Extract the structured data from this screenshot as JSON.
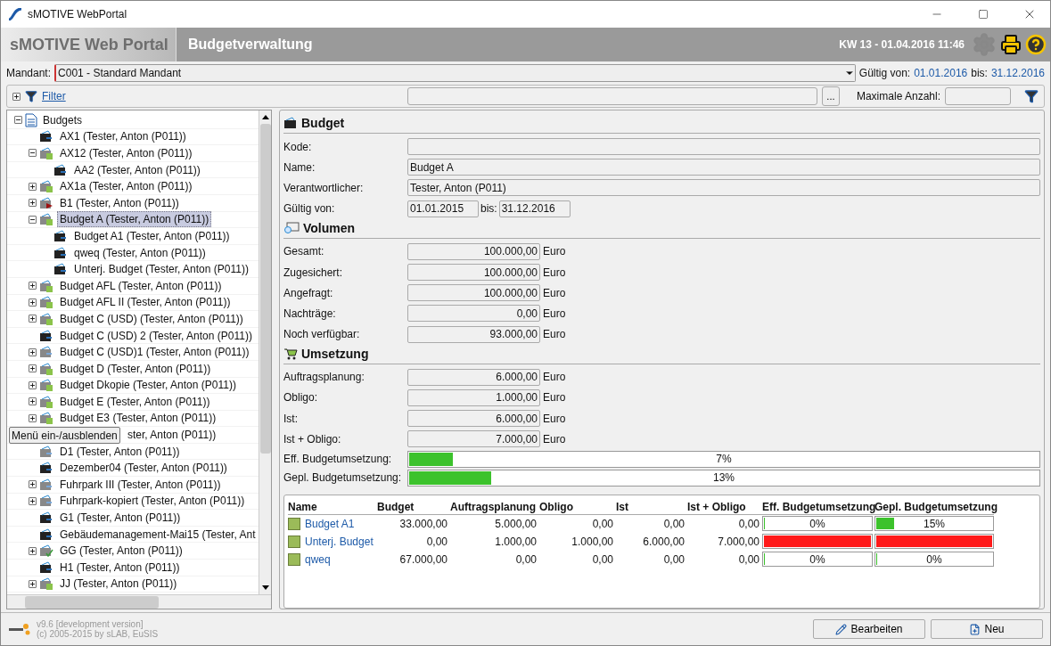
{
  "window": {
    "title": "sMOTIVE WebPortal"
  },
  "header": {
    "brand": "sMOTIVE Web Portal",
    "module": "Budgetverwaltung",
    "datetime": "KW 13 - 01.04.2016 11:46"
  },
  "mandant": {
    "label": "Mandant:",
    "value": "C001 - Standard Mandant",
    "valid_label": "Gültig von:",
    "valid_from": "01.01.2016",
    "to_label": "bis:",
    "valid_to": "31.12.2016"
  },
  "filter": {
    "label": "Filter",
    "expanded": false,
    "browse": "...",
    "max_label": "Maximale Anzahl:"
  },
  "tooltip": "Menü ein-/ausblenden",
  "tree": {
    "label": "Budgets",
    "expanded": true,
    "children": [
      {
        "label": "AX1 (Tester, Anton (P011))",
        "kind": "dark"
      },
      {
        "label": "AX12 (Tester, Anton (P011))",
        "kind": "green",
        "expanded": true,
        "children": [
          {
            "label": "AA2 (Tester, Anton (P011))",
            "kind": "dark"
          }
        ]
      },
      {
        "label": "AX1a (Tester, Anton (P011))",
        "kind": "green",
        "expanded": false
      },
      {
        "label": "B1 (Tester, Anton (P011))",
        "kind": "red",
        "expanded": false
      },
      {
        "label": "Budget A (Tester, Anton (P011))",
        "kind": "green",
        "expanded": true,
        "selected": true,
        "children": [
          {
            "label": "Budget A1 (Tester, Anton (P011))",
            "kind": "dark"
          },
          {
            "label": "qweq (Tester, Anton (P011))",
            "kind": "dark"
          },
          {
            "label": "Unterj. Budget (Tester, Anton (P011))",
            "kind": "dark"
          }
        ]
      },
      {
        "label": "Budget AFL (Tester, Anton (P011))",
        "kind": "green",
        "expanded": false
      },
      {
        "label": "Budget AFL II (Tester, Anton (P011))",
        "kind": "green",
        "expanded": false
      },
      {
        "label": "Budget C (USD) (Tester, Anton (P011))",
        "kind": "green",
        "expanded": false
      },
      {
        "label": "Budget C (USD) 2 (Tester, Anton (P011))",
        "kind": "dark"
      },
      {
        "label": "Budget C (USD)1 (Tester, Anton (P011))",
        "kind": "grey",
        "expanded": false
      },
      {
        "label": "Budget D (Tester, Anton (P011))",
        "kind": "green",
        "expanded": false
      },
      {
        "label": "Budget Dkopie (Tester, Anton (P011))",
        "kind": "green",
        "expanded": false
      },
      {
        "label": "Budget E (Tester, Anton (P011))",
        "kind": "green",
        "expanded": false
      },
      {
        "label": "Budget E3 (Tester, Anton (P011))",
        "kind": "green",
        "expanded": false
      },
      {
        "label": "ster, Anton (P011))",
        "kind": "covered"
      },
      {
        "label": "D1 (Tester, Anton (P011))",
        "kind": "grey"
      },
      {
        "label": "Dezember04 (Tester, Anton (P011))",
        "kind": "dark"
      },
      {
        "label": "Fuhrpark III (Tester, Anton (P011))",
        "kind": "grey",
        "expanded": false
      },
      {
        "label": "Fuhrpark-kopiert (Tester, Anton (P011))",
        "kind": "grey",
        "expanded": false
      },
      {
        "label": "G1 (Tester, Anton (P011))",
        "kind": "dark"
      },
      {
        "label": "Gebäudemanagement-Mai15 (Tester, Ant",
        "kind": "dark"
      },
      {
        "label": "GG (Tester, Anton (P011))",
        "kind": "check",
        "expanded": false
      },
      {
        "label": "H1 (Tester, Anton (P011))",
        "kind": "dark"
      },
      {
        "label": "JJ (Tester, Anton (P011))",
        "kind": "green",
        "expanded": false
      }
    ]
  },
  "budget": {
    "title": "Budget",
    "fields": [
      {
        "label": "Kode:"
      },
      {
        "label": "Name:",
        "value": "Budget A"
      },
      {
        "label": "Verantwortlicher:",
        "value": "Tester, Anton (P011)"
      }
    ],
    "valid": {
      "label": "Gültig von:",
      "from": "01.01.2015",
      "to_label": "bis:",
      "to": "31.12.2016"
    }
  },
  "volumen": {
    "title": "Volumen",
    "rows": [
      {
        "label": "Gesamt:",
        "value": "100.000,00",
        "unit": "Euro"
      },
      {
        "label": "Zugesichert:",
        "value": "100.000,00",
        "unit": "Euro"
      },
      {
        "label": "Angefragt:",
        "value": "100.000,00",
        "unit": "Euro"
      },
      {
        "label": "Nachträge:",
        "value": "0,00",
        "unit": "Euro"
      },
      {
        "label": "Noch verfügbar:",
        "value": "93.000,00",
        "unit": "Euro"
      }
    ]
  },
  "umsetzung": {
    "title": "Umsetzung",
    "rows": [
      {
        "label": "Auftragsplanung:",
        "value": "6.000,00",
        "unit": "Euro"
      },
      {
        "label": "Obligo:",
        "value": "1.000,00",
        "unit": "Euro"
      },
      {
        "label": "Ist:",
        "value": "6.000,00",
        "unit": "Euro"
      },
      {
        "label": "Ist + Obligo:",
        "value": "7.000,00",
        "unit": "Euro"
      }
    ],
    "bars": [
      {
        "label": "Eff. Budgetumsetzung:",
        "level": 0.07,
        "text": "7%"
      },
      {
        "label": "Gepl. Budgetumsetzung:",
        "level": 0.13,
        "text": "13%"
      }
    ]
  },
  "table": {
    "columns": [
      "Name",
      "Budget",
      "Auftragsplanung",
      "Obligo",
      "Ist",
      "Ist + Obligo",
      "Eff. Budgetumsetzung",
      "Gepl. Budgetumsetzung"
    ],
    "rows": [
      {
        "name": "Budget A1",
        "budget": "33.000,00",
        "auftrag": "5.000,00",
        "obligo": "0,00",
        "ist": "0,00",
        "ist_obligo": "0,00",
        "eff": {
          "level": 0,
          "text": "0%"
        },
        "gepl": {
          "level": 0.15,
          "text": "15%"
        }
      },
      {
        "name": "Unterj. Budget",
        "budget": "0,00",
        "auftrag": "1.000,00",
        "obligo": "1.000,00",
        "ist": "6.000,00",
        "ist_obligo": "7.000,00",
        "eff": {
          "level": 1,
          "over": true
        },
        "gepl": {
          "level": 1,
          "over": true
        }
      },
      {
        "name": "qweq",
        "budget": "67.000,00",
        "auftrag": "0,00",
        "obligo": "0,00",
        "ist": "0,00",
        "ist_obligo": "0,00",
        "eff": {
          "level": 0,
          "text": "0%"
        },
        "gepl": {
          "level": 0,
          "text": "0%"
        }
      }
    ]
  },
  "footer": {
    "version": "v9.6 [development version]",
    "copyright": "(c) 2005-2015 by sLAB, EuSIS",
    "buttons": [
      "Bearbeiten",
      "Neu"
    ]
  }
}
